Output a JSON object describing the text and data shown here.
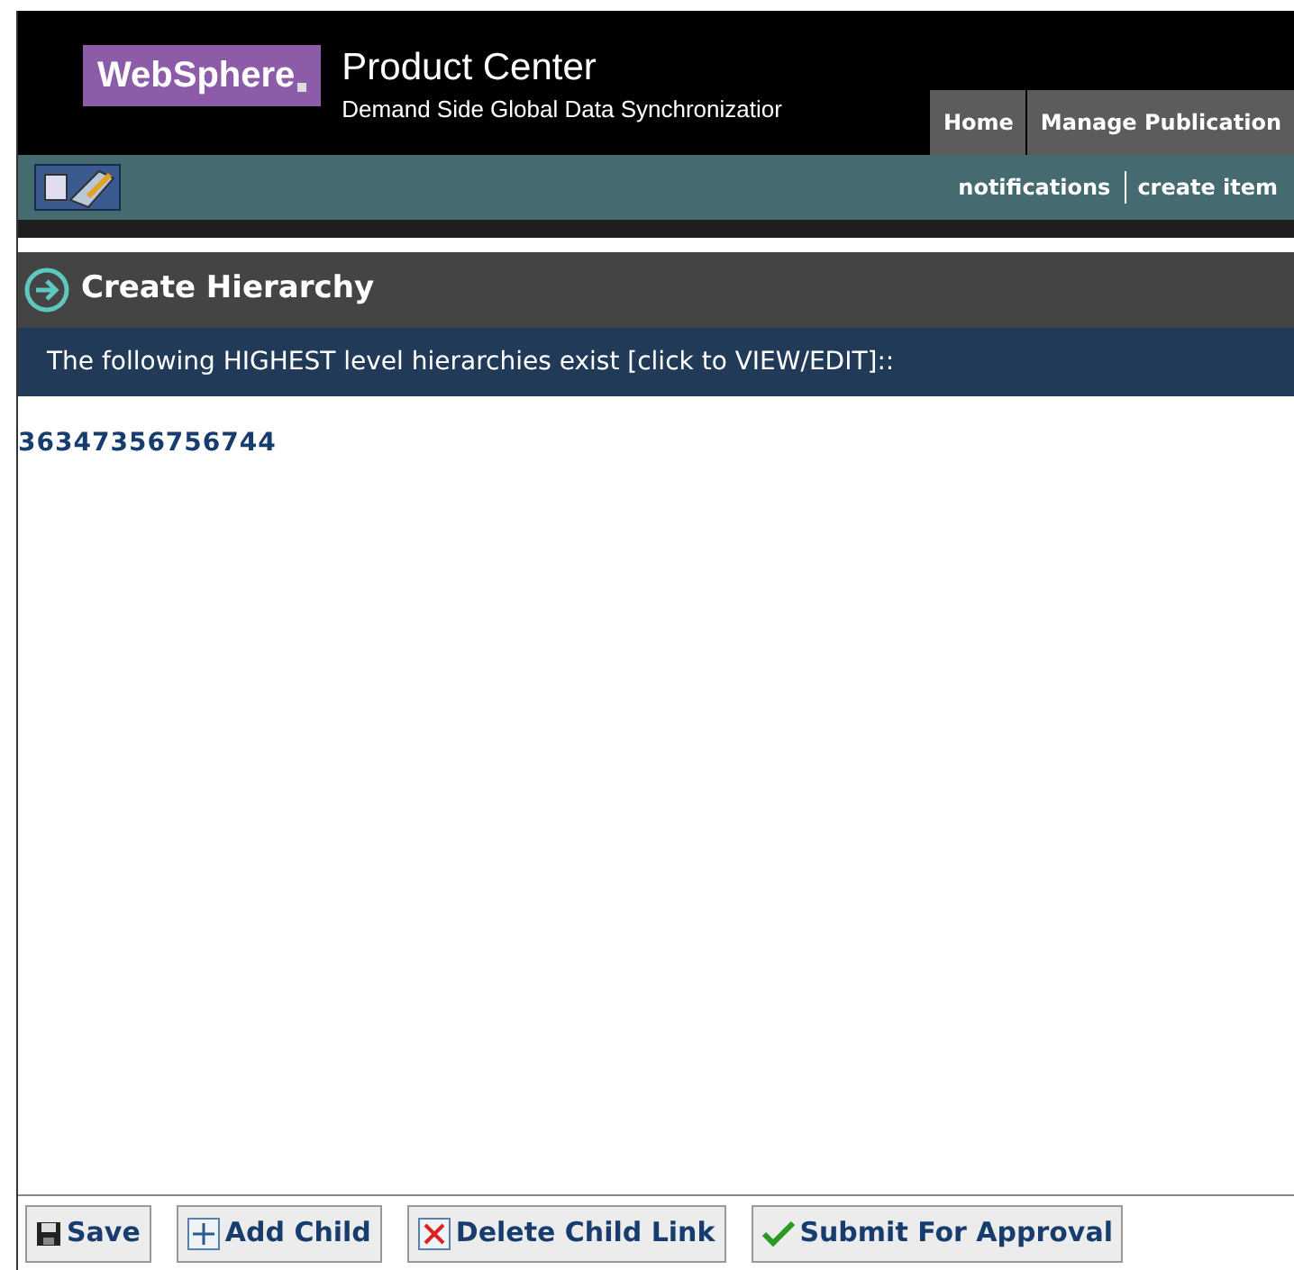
{
  "header": {
    "brand": "WebSphere",
    "product": "Product Center",
    "subtitle": "Demand Side Global Data Synchronizatior"
  },
  "nav_tabs": [
    {
      "label": "Home",
      "selected": false
    },
    {
      "label": "Manage Publication",
      "selected": false
    }
  ],
  "toolbar_links": [
    "notifications",
    "create item"
  ],
  "page_title": "Create Hierarchy",
  "info_bar": "The following HIGHEST level hierarchies exist [click to VIEW/EDIT]::",
  "hierarchies": [
    "36347356756744"
  ],
  "buttons": [
    {
      "label": "Save",
      "kind": "save"
    },
    {
      "label": "Add Child",
      "kind": "add"
    },
    {
      "label": "Delete Child Link",
      "kind": "delete"
    },
    {
      "label": "Submit For Approval",
      "kind": "approve"
    }
  ]
}
